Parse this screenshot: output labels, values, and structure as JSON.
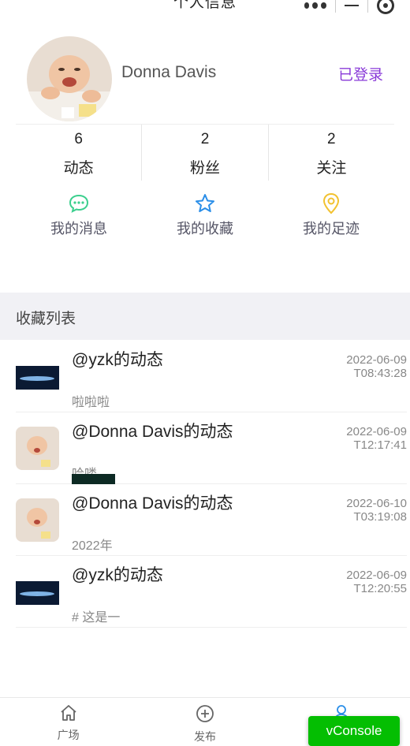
{
  "nav": {
    "title": "个人信息"
  },
  "profile": {
    "name": "Donna Davis",
    "login_label": "已登录"
  },
  "stats": [
    {
      "num": "6",
      "label": "动态"
    },
    {
      "num": "2",
      "label": "粉丝"
    },
    {
      "num": "2",
      "label": "关注"
    }
  ],
  "quick_links": [
    {
      "label": "我的消息",
      "icon": "chat-bubble-icon",
      "color": "#3ccf8e"
    },
    {
      "label": "我的收藏",
      "icon": "star-icon",
      "color": "#2a8ee8"
    },
    {
      "label": "我的足迹",
      "icon": "location-pin-icon",
      "color": "#f2c230"
    }
  ],
  "section": {
    "title": "收藏列表"
  },
  "favorites": [
    {
      "title": "@yzk的动态",
      "date": "2022-06-09T08:43:28",
      "body": "啦啦啦",
      "thumb": "night-sky"
    },
    {
      "title": "@Donna Davis的动态",
      "date": "2022-06-09T12:17:41",
      "body": "哈喽",
      "thumb": "baby"
    },
    {
      "title": "@Donna Davis的动态",
      "date": "2022-06-10T03:19:08",
      "body": "2022年",
      "thumb": "baby"
    },
    {
      "title": "@yzk的动态",
      "date": "2022-06-09T12:20:55",
      "body": "# 这是一",
      "thumb": "night-sky"
    }
  ],
  "tabbar": [
    {
      "label": "广场",
      "icon": "home-icon"
    },
    {
      "label": "发布",
      "icon": "plus-circle-icon"
    },
    {
      "label": "",
      "icon": "user-icon",
      "color": "#2a8ee8"
    }
  ],
  "vconsole": {
    "label": "vConsole",
    "color": "#04be02"
  },
  "accent": {
    "login": "#8a3bd8"
  }
}
